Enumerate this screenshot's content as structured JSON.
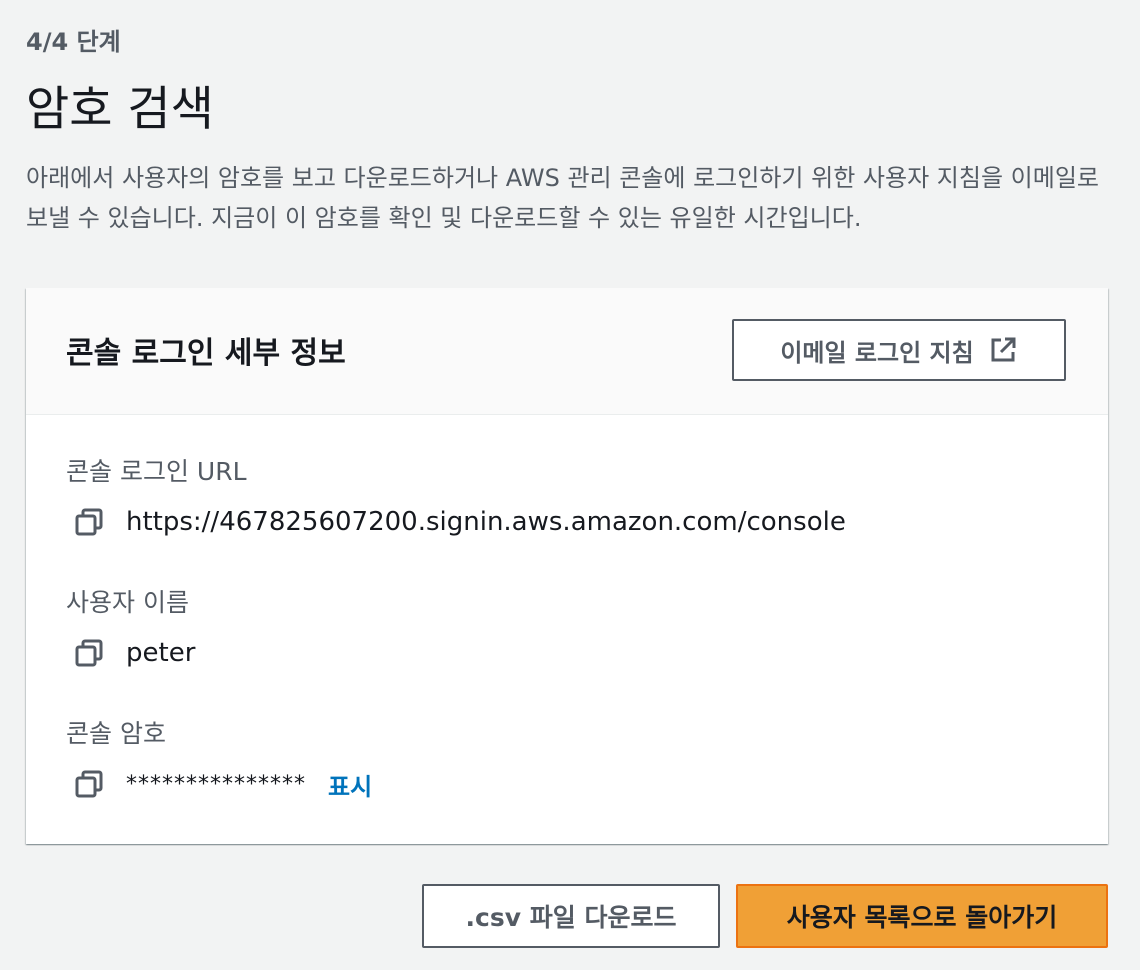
{
  "page": {
    "step": "4/4 단계",
    "title": "암호 검색",
    "description": "아래에서 사용자의 암호를 보고 다운로드하거나 AWS 관리 콘솔에 로그인하기 위한 사용자 지침을 이메일로 보낼 수 있습니다. 지금이 이 암호를 확인 및 다운로드할 수 있는 유일한 시간입니다."
  },
  "card": {
    "title": "콘솔 로그인 세부 정보",
    "email_button_label": "이메일 로그인 지침",
    "email_button_icon": "external-link-icon",
    "fields": {
      "url": {
        "label": "콘솔 로그인 URL",
        "value": "https://467825607200.signin.aws.amazon.com/console",
        "icon": "copy-icon"
      },
      "username": {
        "label": "사용자 이름",
        "value": "peter",
        "icon": "copy-icon"
      },
      "password": {
        "label": "콘솔 암호",
        "value": "***************",
        "show_label": "표시",
        "icon": "copy-icon"
      }
    }
  },
  "footer": {
    "csv_button_label": ".csv 파일 다운로드",
    "back_button_label": "사용자 목록으로 돌아가기"
  },
  "colors": {
    "primary_button": "#f0a036",
    "link": "#0073bb",
    "secondary_text": "#545b64",
    "background": "#f2f3f3"
  }
}
